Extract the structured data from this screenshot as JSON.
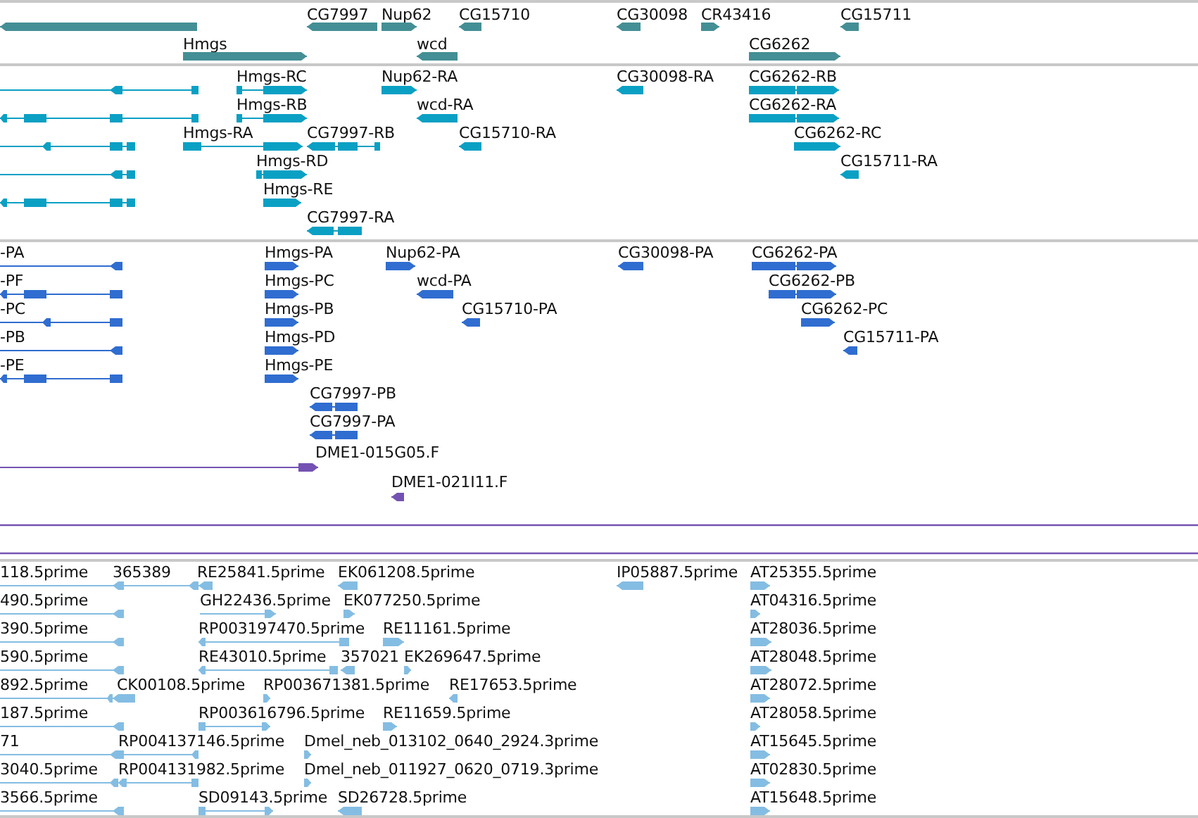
{
  "tracks": [
    {
      "kind": "gene",
      "features": [
        {
          "reverse": true
        },
        {
          "label": "CG7997",
          "reverse": true
        },
        {
          "label": "Nup62",
          "reverse": false
        },
        {
          "label": "CG15710",
          "reverse": true
        },
        {
          "label": "CG30098",
          "reverse": true
        },
        {
          "label": "CR43416",
          "reverse": false
        },
        {
          "label": "CG15711",
          "reverse": true
        },
        {
          "label": "Hmgs",
          "reverse": false
        },
        {
          "label": "wcd",
          "reverse": true
        },
        {
          "label": "CG6262",
          "reverse": false
        }
      ]
    },
    {
      "kind": "transcript",
      "features": [
        {
          "reverse": true
        },
        {
          "label": "Hmgs-RC",
          "reverse": false
        },
        {
          "label": "Nup62-RA",
          "reverse": false
        },
        {
          "label": "CG30098-RA",
          "reverse": true
        },
        {
          "label": "CG6262-RB",
          "reverse": false
        },
        {
          "reverse": true
        },
        {
          "label": "Hmgs-RB",
          "reverse": false
        },
        {
          "label": "wcd-RA",
          "reverse": true
        },
        {
          "label": "CG6262-RA",
          "reverse": false
        },
        {
          "reverse": true
        },
        {
          "label": "Hmgs-RA",
          "reverse": false
        },
        {
          "label": "CG7997-RB",
          "reverse": true
        },
        {
          "label": "CG15710-RA",
          "reverse": true
        },
        {
          "label": "CG6262-RC",
          "reverse": false
        },
        {
          "reverse": true
        },
        {
          "label": "Hmgs-RD",
          "reverse": false
        },
        {
          "label": "CG15711-RA",
          "reverse": true
        },
        {
          "reverse": true
        },
        {
          "label": "Hmgs-RE",
          "reverse": false
        },
        {
          "label": "CG7997-RA",
          "reverse": true
        }
      ]
    },
    {
      "kind": "protein",
      "features": [
        {
          "label": "-PA",
          "reverse": true
        },
        {
          "label": "Hmgs-PA",
          "reverse": false
        },
        {
          "label": "Nup62-PA",
          "reverse": false
        },
        {
          "label": "CG30098-PA",
          "reverse": true
        },
        {
          "label": "CG6262-PA",
          "reverse": false
        },
        {
          "label": "-PF",
          "reverse": true
        },
        {
          "label": "Hmgs-PC",
          "reverse": false
        },
        {
          "label": "wcd-PA",
          "reverse": true
        },
        {
          "label": "CG6262-PB",
          "reverse": false
        },
        {
          "label": "-PC",
          "reverse": true
        },
        {
          "label": "Hmgs-PB",
          "reverse": false
        },
        {
          "label": "CG15710-PA",
          "reverse": true
        },
        {
          "label": "CG6262-PC",
          "reverse": false
        },
        {
          "label": "-PB",
          "reverse": true
        },
        {
          "label": "Hmgs-PD",
          "reverse": false
        },
        {
          "label": "CG15711-PA",
          "reverse": true
        },
        {
          "label": "-PE",
          "reverse": true
        },
        {
          "label": "Hmgs-PE",
          "reverse": false
        },
        {
          "label": "CG7997-PB",
          "reverse": true
        },
        {
          "label": "CG7997-PA",
          "reverse": true
        }
      ]
    },
    {
      "kind": "clone",
      "features": [
        {
          "label": "DME1-015G05.F",
          "reverse": false
        },
        {
          "label": "DME1-021I11.F",
          "reverse": true
        }
      ]
    },
    {
      "kind": "span"
    },
    {
      "kind": "est",
      "features": [
        {
          "label": "118.5prime",
          "reverse": true
        },
        {
          "label": "365389",
          "reverse": true
        },
        {
          "label": "RE25841.5prime",
          "reverse": true
        },
        {
          "label": "EK061208.5prime",
          "reverse": true
        },
        {
          "label": "IP05887.5prime",
          "reverse": true
        },
        {
          "label": "AT25355.5prime",
          "reverse": false
        },
        {
          "label": "490.5prime",
          "reverse": true
        },
        {
          "label": "GH22436.5prime",
          "reverse": false
        },
        {
          "label": "EK077250.5prime",
          "reverse": false
        },
        {
          "label": "AT04316.5prime",
          "reverse": false
        },
        {
          "label": "390.5prime",
          "reverse": true
        },
        {
          "label": "RP003197470.5prime",
          "reverse": true
        },
        {
          "label": "RE11161.5prime",
          "reverse": false
        },
        {
          "label": "AT28036.5prime",
          "reverse": false
        },
        {
          "label": "590.5prime",
          "reverse": true
        },
        {
          "label": "RE43010.5prime",
          "reverse": true
        },
        {
          "label": "357021",
          "reverse": true
        },
        {
          "label": "EK269647.5prime",
          "reverse": false
        },
        {
          "label": "AT28048.5prime",
          "reverse": false
        },
        {
          "label": "892.5prime",
          "reverse": true
        },
        {
          "label": "CK00108.5prime",
          "reverse": true
        },
        {
          "label": "RP003671381.5prime",
          "reverse": false
        },
        {
          "label": "RE17653.5prime",
          "reverse": true
        },
        {
          "label": "AT28072.5prime",
          "reverse": false
        },
        {
          "label": "187.5prime",
          "reverse": true
        },
        {
          "label": "RP003616796.5prime",
          "reverse": false
        },
        {
          "label": "RE11659.5prime",
          "reverse": false
        },
        {
          "label": "AT28058.5prime",
          "reverse": false
        },
        {
          "label": "71",
          "reverse": true
        },
        {
          "label": "RP004137146.5prime",
          "reverse": true
        },
        {
          "label": "Dmel_neb_013102_0640_2924.3prime",
          "reverse": false
        },
        {
          "label": "AT15645.5prime",
          "reverse": false
        },
        {
          "label": "3040.5prime",
          "reverse": true
        },
        {
          "label": "RP004131982.5prime",
          "reverse": true
        },
        {
          "label": "Dmel_neb_011927_0620_0719.3prime",
          "reverse": false
        },
        {
          "label": "AT02830.5prime",
          "reverse": false
        },
        {
          "label": "3566.5prime",
          "reverse": true
        },
        {
          "label": "SD09143.5prime",
          "reverse": false
        },
        {
          "label": "SD26728.5prime",
          "reverse": true
        },
        {
          "label": "AT15648.5prime",
          "reverse": false
        }
      ]
    }
  ]
}
